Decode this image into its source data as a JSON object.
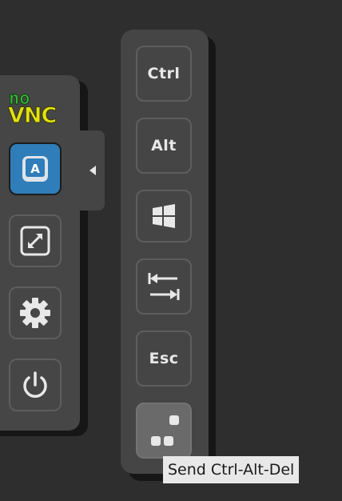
{
  "logo": {
    "line1": "no",
    "line2": "VNC"
  },
  "control_bar": {
    "buttons": [
      {
        "icon": "keyboard-icon",
        "selected": true
      },
      {
        "icon": "fullscreen-icon",
        "selected": false
      },
      {
        "icon": "gear-icon",
        "selected": false
      },
      {
        "icon": "power-icon",
        "selected": false
      }
    ],
    "handle_icon": "caret-left-icon"
  },
  "extra_keys": {
    "ctrl_label": "Ctrl",
    "alt_label": "Alt",
    "windows_icon": "windows-icon",
    "tab_icon": "tab-icon",
    "esc_label": "Esc",
    "ctrl_alt_del_icon": "ctrl-alt-del-icon"
  },
  "tooltip": {
    "text": "Send Ctrl-Alt-Del"
  },
  "colors": {
    "background": "#2e2e2e",
    "panel": "#464646",
    "selected_button": "#2f7db9",
    "logo_green": "#3bb53b",
    "logo_yellow": "#e2e20e"
  }
}
